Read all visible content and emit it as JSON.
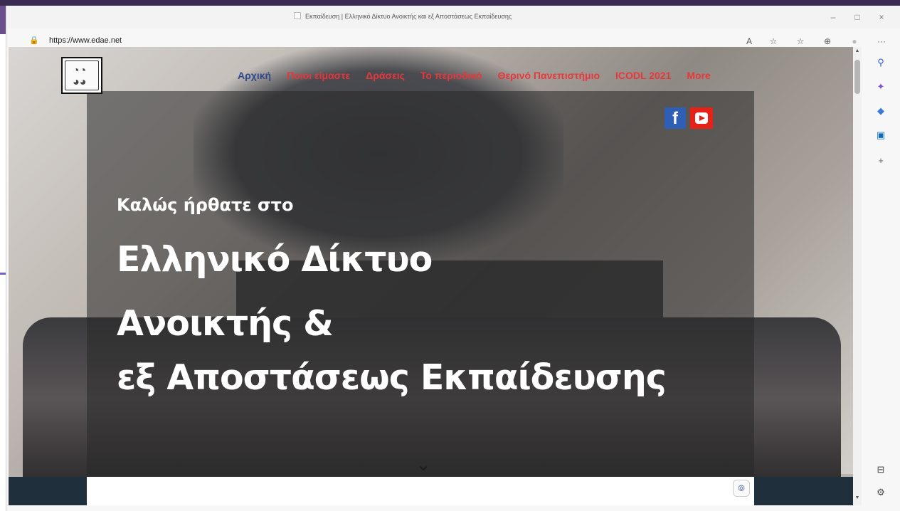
{
  "window": {
    "title": "Εκπαίδευση | Ελληνικό Δίκτυο Ανοικτής και εξ Αποστάσεως Εκπαίδευσης",
    "controls": [
      "–",
      "□",
      "×"
    ]
  },
  "address_bar": {
    "url": "https://www.edae.net",
    "toolbar_icons": {
      "read_aloud": "A",
      "favorite_add": "☆",
      "favorites": "☆",
      "collections": "⊕",
      "profile": "●",
      "more": "···"
    }
  },
  "site": {
    "nav": [
      {
        "label": "Αρχική",
        "active": true
      },
      {
        "label": "Ποιοι είμαστε",
        "active": false
      },
      {
        "label": "Δράσεις",
        "active": false
      },
      {
        "label": "Το περιοδικό",
        "active": false
      },
      {
        "label": "Θερινό Πανεπιστήμιο",
        "active": false
      },
      {
        "label": "ICODL 2021",
        "active": false
      },
      {
        "label": "More",
        "active": false
      }
    ],
    "social": {
      "facebook": "f"
    },
    "hero": {
      "welcome": "Καλώς ήρθατε στο",
      "line1": "Ελληνικό Δίκτυο",
      "line2": "Ανοικτής &",
      "line3": "εξ Αποστάσεως Εκπαίδευσης"
    },
    "scroll_down_glyph": "⌄"
  },
  "colors": {
    "nav_link": "#e8373b",
    "nav_active": "#2d4a8c",
    "footer_band": "#1f2f3c"
  },
  "sidebar_icons": [
    "search-icon",
    "copilot-icon",
    "shopping-icon",
    "outlook-icon",
    "add-icon",
    "split-screen-icon",
    "settings-icon"
  ]
}
